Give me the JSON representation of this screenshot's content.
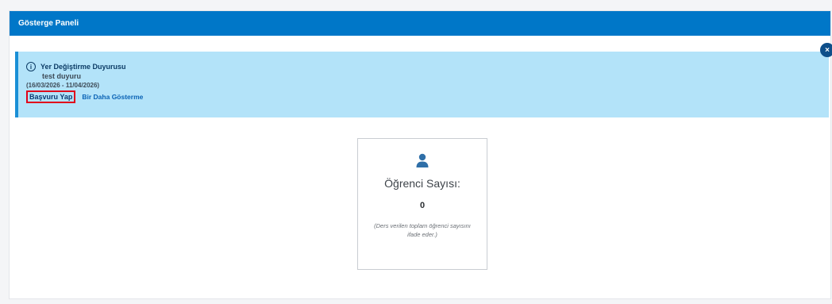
{
  "header": {
    "title": "Gösterge Paneli"
  },
  "announcement": {
    "close_label": "×",
    "info_icon": "info-icon",
    "title": "Yer Değiştirme Duyurusu",
    "subtitle": "test duyuru",
    "dates": "(16/03/2026 - 11/04/2026)",
    "apply_label": "Başvuru Yap",
    "dismiss_label": "Bir Daha Gösterme"
  },
  "stat_card": {
    "icon": "user-icon",
    "label": "Öğrenci Sayısı:",
    "value": "0",
    "description": "(Ders verilen toplam öğrenci sayısını ifade eder.)"
  },
  "colors": {
    "header": "#0077c8",
    "alert_bg": "#b3e3f9",
    "alert_border": "#1a8fd6",
    "highlight": "#e0001b",
    "icon": "#2f6fa8"
  }
}
